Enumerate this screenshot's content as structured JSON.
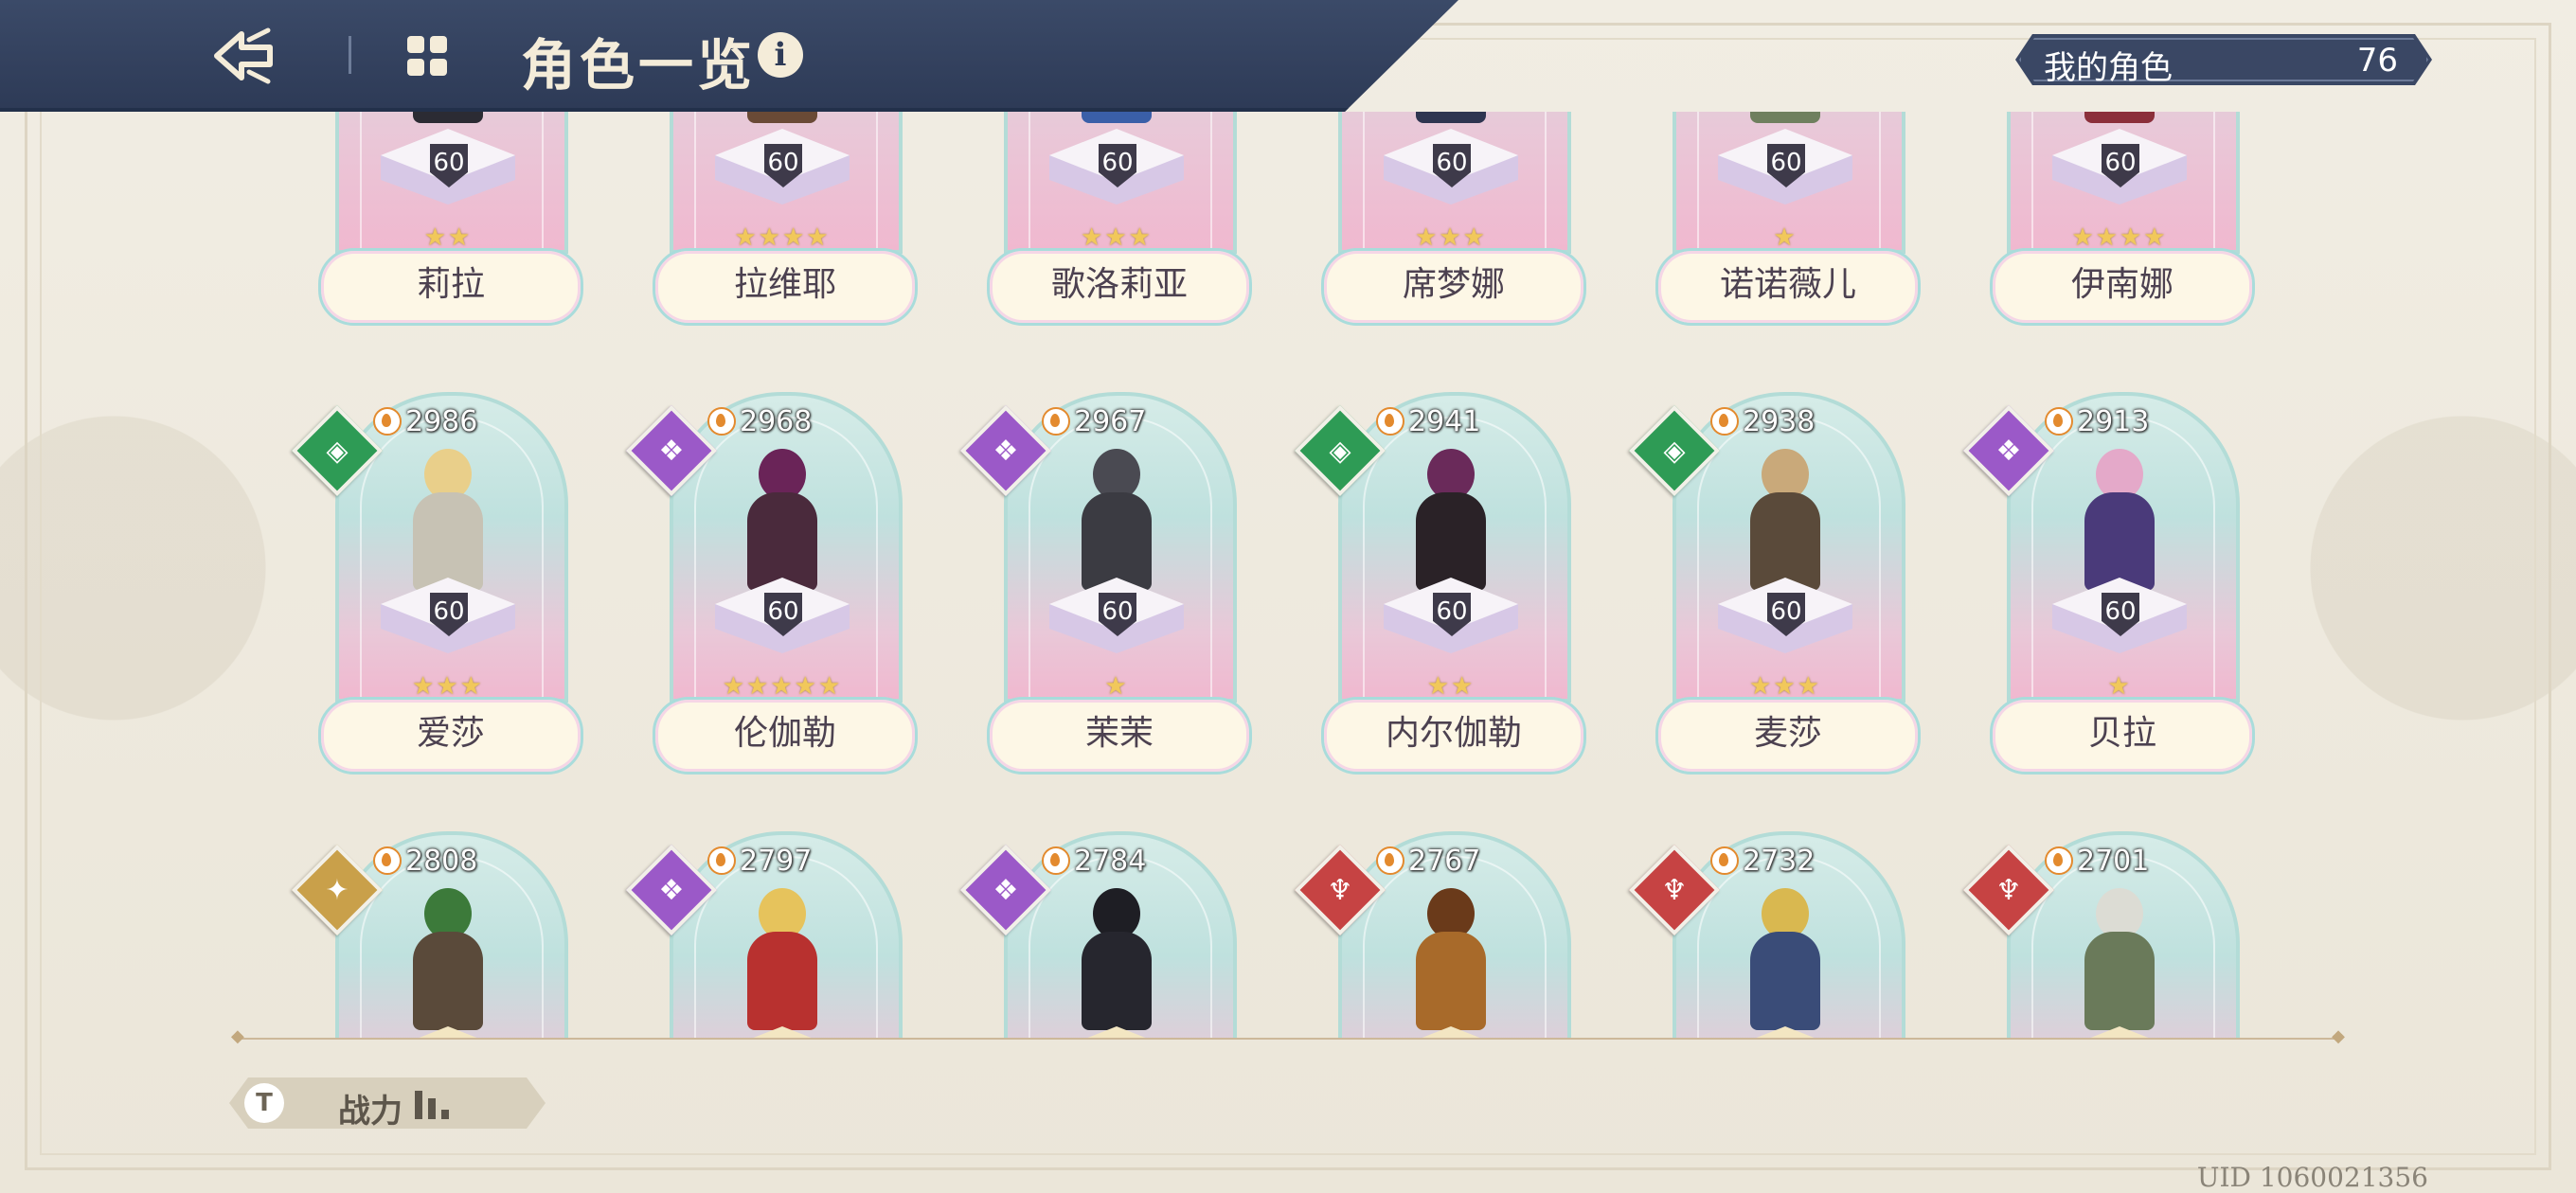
{
  "header": {
    "title": "角色一览",
    "info": "i"
  },
  "owned": {
    "label": "我的角色",
    "count": "76"
  },
  "rows": [
    {
      "kind": "top",
      "cards": [
        {
          "name": "莉拉",
          "level": "60",
          "stars": "★★",
          "body": "#2b2b33",
          "head": "#2b2b33"
        },
        {
          "name": "拉维耶",
          "level": "60",
          "stars": "★★★★",
          "body": "#6a4a36",
          "head": "#3a2a22"
        },
        {
          "name": "歌洛莉亚",
          "level": "60",
          "stars": "★★★",
          "body": "#3a5fa8",
          "head": "#e8d37a"
        },
        {
          "name": "席梦娜",
          "level": "60",
          "stars": "★★★",
          "body": "#2e3550",
          "head": "#e9e3d6"
        },
        {
          "name": "诺诺薇儿",
          "level": "60",
          "stars": "★",
          "body": "#6f7f5e",
          "head": "#c9c8b8"
        },
        {
          "name": "伊南娜",
          "level": "60",
          "stars": "★★★★",
          "body": "#8b2f3a",
          "head": "#c83c4a"
        }
      ]
    },
    {
      "kind": "full",
      "cards": [
        {
          "name": "爱莎",
          "level": "60",
          "stars": "★★★",
          "power": "2986",
          "element": "green",
          "glyph": "◈",
          "body": "#c7c2b4",
          "head": "#e9cf8a"
        },
        {
          "name": "伦伽勒",
          "level": "60",
          "stars": "★★★★★",
          "power": "2968",
          "element": "purple",
          "glyph": "❖",
          "body": "#4a2a3c",
          "head": "#6a2458"
        },
        {
          "name": "茉茉",
          "level": "60",
          "stars": "★",
          "power": "2967",
          "element": "purple",
          "glyph": "❖",
          "body": "#3b3b42",
          "head": "#4a4a52"
        },
        {
          "name": "内尔伽勒",
          "level": "60",
          "stars": "★★",
          "power": "2941",
          "element": "green",
          "glyph": "◈",
          "body": "#2a2227",
          "head": "#6a2a5a"
        },
        {
          "name": "麦莎",
          "level": "60",
          "stars": "★★★",
          "power": "2938",
          "element": "green",
          "glyph": "◈",
          "body": "#5a4a3a",
          "head": "#c9a97a"
        },
        {
          "name": "贝拉",
          "level": "60",
          "stars": "★",
          "power": "2913",
          "element": "purple",
          "glyph": "❖",
          "body": "#4a3a7a",
          "head": "#e4a9c9"
        }
      ]
    },
    {
      "kind": "partial",
      "cards": [
        {
          "power": "2808",
          "element": "gold",
          "glyph": "✦",
          "body": "#5a4a3a",
          "head": "#3c7a3a"
        },
        {
          "power": "2797",
          "element": "purple",
          "glyph": "❖",
          "body": "#b8312f",
          "head": "#e6c35c"
        },
        {
          "power": "2784",
          "element": "purple",
          "glyph": "❖",
          "body": "#26262e",
          "head": "#1e1e24"
        },
        {
          "power": "2767",
          "element": "red",
          "glyph": "♆",
          "body": "#a86a2a",
          "head": "#6a3a1a"
        },
        {
          "power": "2732",
          "element": "red",
          "glyph": "♆",
          "body": "#3a4c78",
          "head": "#d9b850"
        },
        {
          "power": "2701",
          "element": "red",
          "glyph": "♆",
          "body": "#6a7a5a",
          "head": "#dcdcd4"
        }
      ]
    }
  ],
  "sort": {
    "icon": "T",
    "label": "战力"
  },
  "uid": "UID 1060021356",
  "colors": {
    "header": "#2f3c59",
    "background": "#efebe0",
    "nameplate": "#fdf7e6"
  }
}
